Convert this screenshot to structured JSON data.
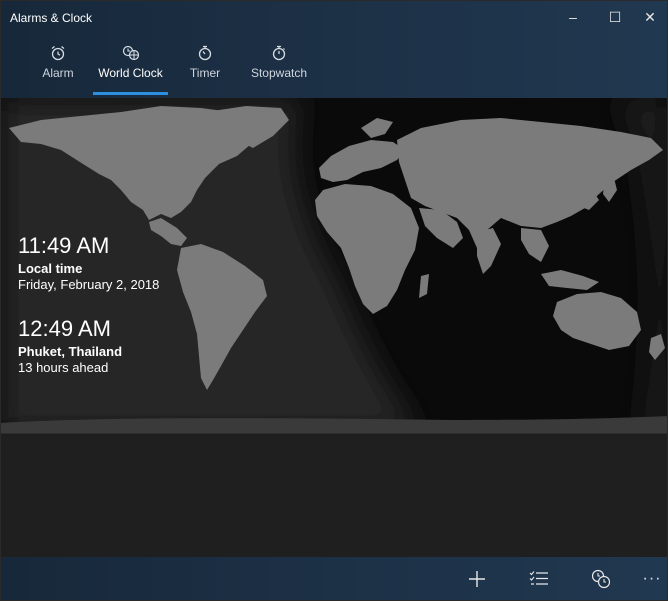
{
  "window": {
    "title": "Alarms & Clock"
  },
  "window_controls": {
    "minimize": "–",
    "maximize": "☐",
    "close": "✕"
  },
  "tabs": [
    {
      "label": "Alarm",
      "icon": "alarm-clock-icon",
      "glyph": "⏰"
    },
    {
      "label": "World Clock",
      "icon": "globe-clock-icon",
      "glyph": "◷",
      "active": true
    },
    {
      "label": "Timer",
      "icon": "timer-icon",
      "glyph": "◔"
    },
    {
      "label": "Stopwatch",
      "icon": "stopwatch-icon",
      "glyph": "◷"
    }
  ],
  "clocks": [
    {
      "time": "11:49 AM",
      "place": "Local time",
      "detail": "Friday, February 2, 2018"
    },
    {
      "time": "12:49 AM",
      "place": "Phuket, Thailand",
      "detail": "13 hours ahead"
    }
  ],
  "commands": [
    {
      "name": "add-city",
      "glyph": "+",
      "icon": "plus-icon"
    },
    {
      "name": "select-mode",
      "glyph": "☰",
      "icon": "checklist-icon"
    },
    {
      "name": "compare",
      "glyph": "⌚",
      "icon": "compare-clocks-icon"
    },
    {
      "name": "more",
      "glyph": "···",
      "icon": "more-icon"
    }
  ],
  "colors": {
    "titlebar": "#1d3147",
    "accent": "#2d8fe0",
    "map_land": "#7b7b7b",
    "background": "#1f1f1f"
  }
}
